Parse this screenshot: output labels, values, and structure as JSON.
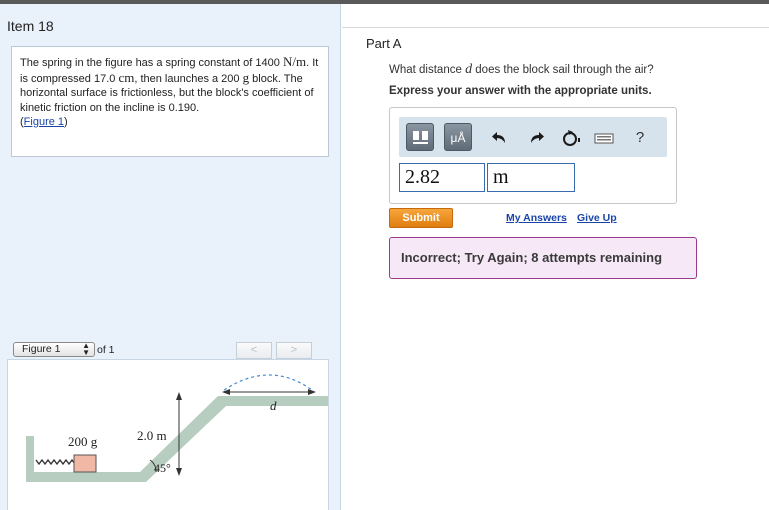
{
  "item": {
    "title": "Item 18"
  },
  "problem": {
    "t1": "The spring in the figure has a spring constant of 1400",
    "unit_nm": "N/m",
    "t2": ". It is compressed 17.0",
    "unit_cm": "cm",
    "t3": ", then launches a 200",
    "unit_g": "g",
    "t4": "block. The horizontal surface is frictionless, but the block's coefficient of kinetic friction on the incline is 0.190.",
    "figure_link": "Figure 1"
  },
  "figure": {
    "select_label": "Figure 1",
    "of_label": "of 1",
    "prev": "<",
    "next": ">",
    "labels": {
      "mass": "200 g",
      "height": "2.0 m",
      "angle": "45°",
      "distance": "d"
    }
  },
  "part": {
    "title": "Part A",
    "question_a": "What distance",
    "question_var": "d",
    "question_b": "does the block sail through the air?",
    "instruction": "Express your answer with the appropriate units."
  },
  "toolbar": {
    "icons": [
      "templates-icon",
      "units-icon",
      "undo-icon",
      "redo-icon",
      "reset-icon",
      "keyboard-icon",
      "help-icon"
    ],
    "units_label": "μÅ",
    "help_label": "?"
  },
  "answer": {
    "value": "2.82",
    "unit": "m"
  },
  "actions": {
    "submit": "Submit",
    "my_answers": "My Answers",
    "give_up": "Give Up"
  },
  "feedback": {
    "message": "Incorrect; Try Again; 8 attempts remaining"
  },
  "colors": {
    "left_bg": "#e9f2fa",
    "link": "#1a44a8",
    "submit": "#ee8e1d",
    "feedback_border": "#9a3a8f",
    "feedback_bg": "#f6e8f7"
  }
}
